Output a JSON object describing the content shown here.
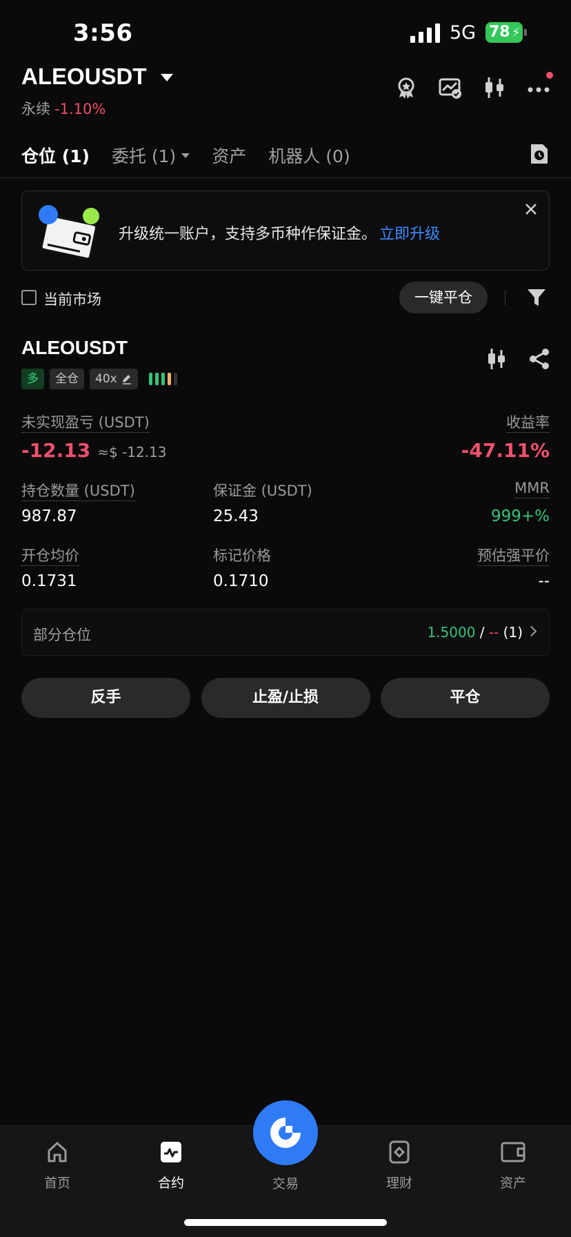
{
  "status_bar": {
    "time": "3:56",
    "network": "5G",
    "battery": "78"
  },
  "header": {
    "pair": "ALEOUSDT",
    "type_label": "永续",
    "change": "-1.10%"
  },
  "tabs": [
    {
      "label": "仓位 (1)"
    },
    {
      "label": "委托 (1)"
    },
    {
      "label": "资产"
    },
    {
      "label": "机器人 (0)"
    }
  ],
  "banner": {
    "text": "升级统一账户，支持多币种作保证金。",
    "link": "立即升级"
  },
  "filters": {
    "current_market": "当前市场",
    "close_all": "一键平仓"
  },
  "position": {
    "symbol": "ALEOUSDT",
    "side": "多",
    "margin_mode": "全仓",
    "leverage": "40x",
    "unrealized_pnl_label": "未实现盈亏 (USDT)",
    "unrealized_pnl": "-12.13",
    "unrealized_pnl_usd": "≈$ -12.13",
    "roe_label": "收益率",
    "roe": "-47.11%",
    "size_label": "持仓数量 (USDT)",
    "size": "987.87",
    "margin_label": "保证金 (USDT)",
    "margin": "25.43",
    "mmr_label": "MMR",
    "mmr": "999+%",
    "entry_label": "开仓均价",
    "entry": "0.1731",
    "mark_label": "标记价格",
    "mark": "0.1710",
    "liq_label": "预估强平价",
    "liq": "--",
    "partial_label": "部分仓位",
    "partial_value": "1.5000",
    "partial_sep": " / ",
    "partial_dash": "--",
    "partial_count": " (1)"
  },
  "actions": {
    "reverse": "反手",
    "tpsl": "止盈/止损",
    "close": "平仓"
  },
  "nav": {
    "home": "首页",
    "futures": "合约",
    "trade": "交易",
    "earn": "理财",
    "assets": "资产"
  },
  "colors": {
    "negative": "#f0506e",
    "positive": "#35c47a",
    "accent": "#2f7bf5",
    "link": "#3d8bff"
  }
}
